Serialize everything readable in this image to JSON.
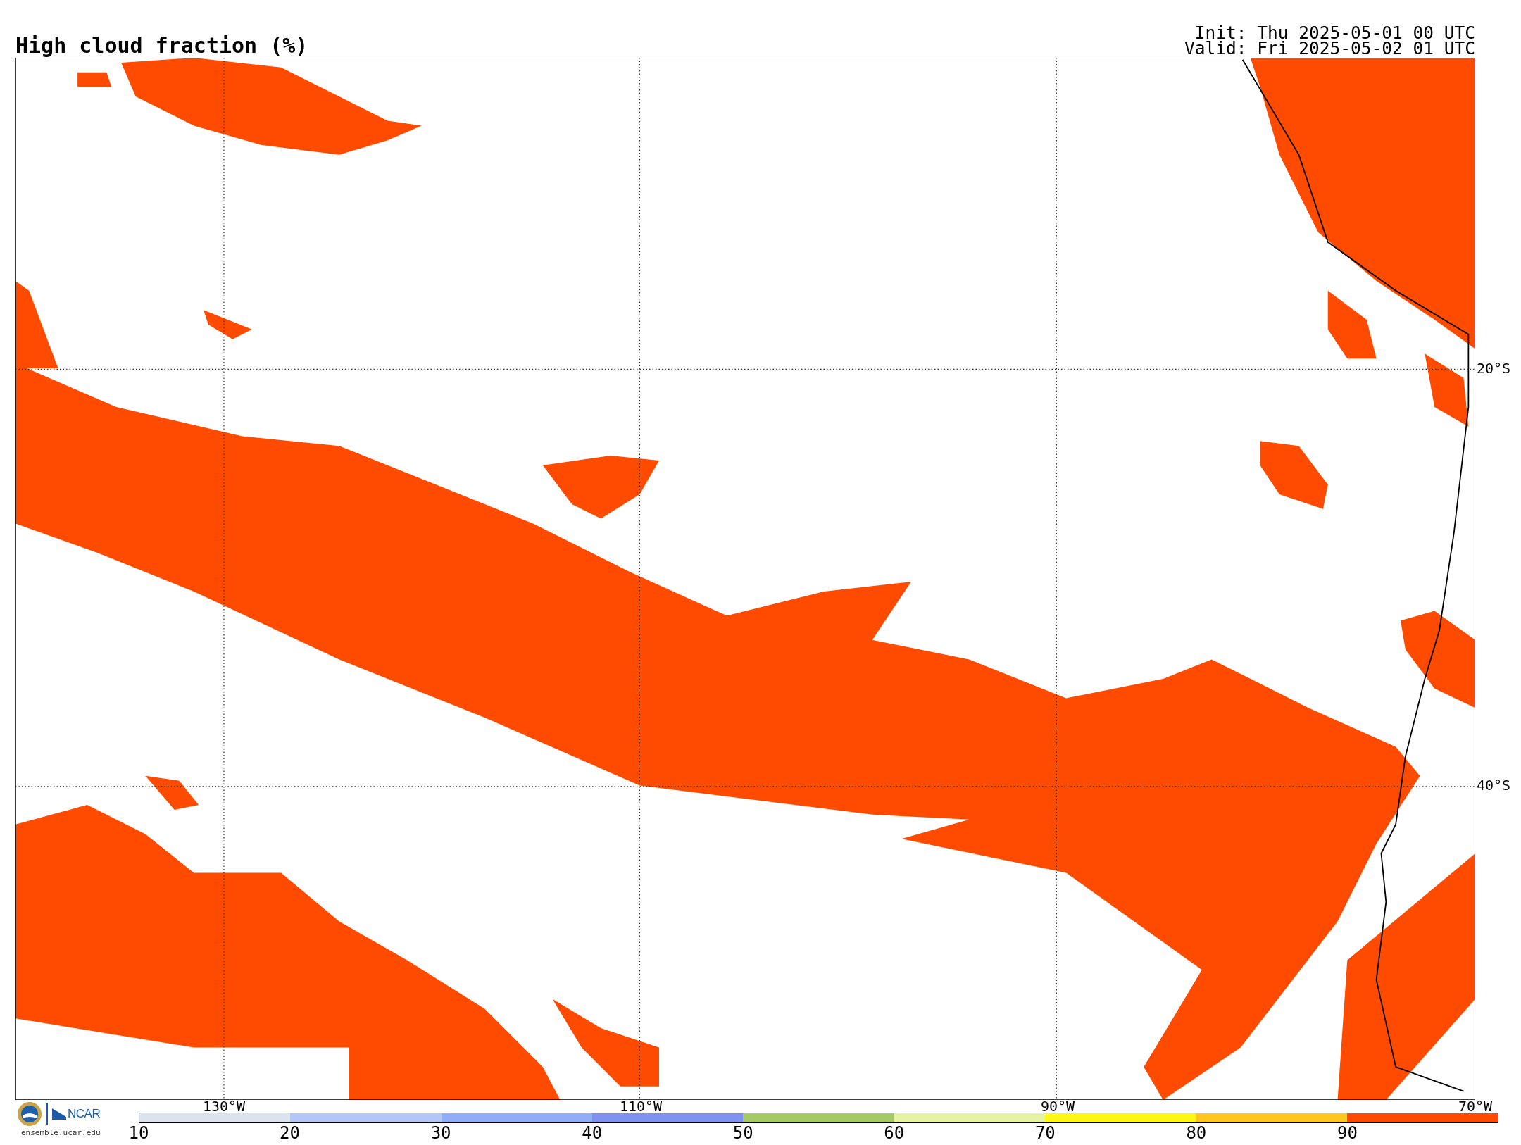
{
  "title": "High cloud fraction (%)",
  "init": "Init: Thu 2025-05-01 00 UTC",
  "valid": "Valid: Fri 2025-05-02 01 UTC",
  "map": {
    "lon_labels": [
      "130°W",
      "110°W",
      "90°W",
      "70°W"
    ],
    "lat_labels": [
      "20°S",
      "40°S"
    ]
  },
  "colorbar": {
    "bins": [
      {
        "color": "#dbe4ee"
      },
      {
        "color": "#b3c7f6"
      },
      {
        "color": "#90aef8"
      },
      {
        "color": "#7f90f0"
      },
      {
        "color": "#a5c963"
      },
      {
        "color": "#e6f3a2"
      },
      {
        "color": "#fff614"
      },
      {
        "color": "#ffc61e"
      },
      {
        "color": "#ff4b00"
      }
    ],
    "ticks": [
      "10",
      "20",
      "30",
      "40",
      "50",
      "60",
      "70",
      "80",
      "90"
    ]
  },
  "footer": {
    "logo_text": "NCAR",
    "url": "ensemble.ucar.edu"
  }
}
